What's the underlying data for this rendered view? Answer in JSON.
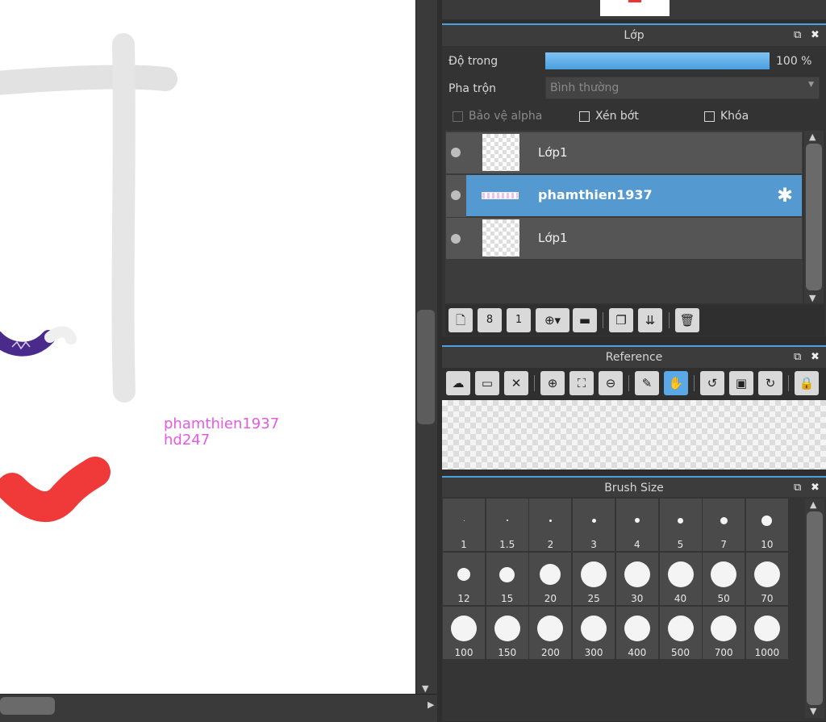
{
  "canvas": {
    "watermark_line1": "phamthien1937",
    "watermark_line2": "hd247",
    "colors": {
      "watermark": "#e45ae4",
      "red_stroke": "#f03a3a",
      "purple_stroke": "#4a2b8c",
      "gray_stroke": "#e2e2e2"
    }
  },
  "layer_panel": {
    "title": "Lớp",
    "opacity_label": "Độ trong",
    "opacity_value": "100 %",
    "opacity": 1.0,
    "blend_label": "Pha trộn",
    "blend_value": "Bình thường",
    "protect_alpha_label": "Bảo vệ alpha",
    "clip_label": "Xén bớt",
    "lock_label": "Khóa",
    "layers": [
      {
        "name": "Lớp1",
        "selected": false
      },
      {
        "name": "phamthien1937",
        "selected": true
      },
      {
        "name": "Lớp1",
        "selected": false
      }
    ],
    "toolbar_icons": [
      "new-layer-icon",
      "new-8bit-layer-icon",
      "new-1bit-layer-icon",
      "add-layer-menu-icon",
      "folder-icon",
      "duplicate-layer-icon",
      "merge-layer-icon",
      "delete-layer-icon"
    ]
  },
  "reference_panel": {
    "title": "Reference",
    "toolbar_icons": [
      "cloud-download-icon",
      "open-folder-icon",
      "close-icon",
      "zoom-in-icon",
      "fit-icon",
      "zoom-out-icon",
      "eyedropper-icon",
      "hand-icon",
      "rotate-left-icon",
      "actual-size-icon",
      "rotate-right-icon",
      "lock-icon"
    ]
  },
  "brush_panel": {
    "title": "Brush Size",
    "sizes": [
      "1",
      "1.5",
      "2",
      "3",
      "4",
      "5",
      "7",
      "10",
      "12",
      "15",
      "20",
      "25",
      "30",
      "40",
      "50",
      "70",
      "100",
      "150",
      "200",
      "300",
      "400",
      "500",
      "700",
      "1000"
    ]
  }
}
